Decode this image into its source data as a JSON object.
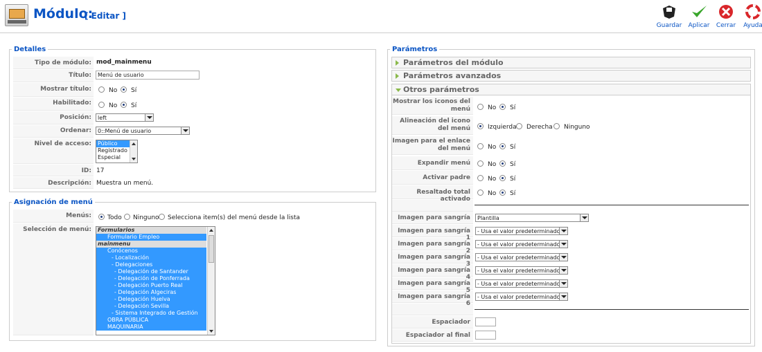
{
  "header": {
    "title": "Módulo:",
    "subtitle": "[ Editar ]",
    "toolbar": [
      {
        "label": "Guardar",
        "icon": "save-icon"
      },
      {
        "label": "Aplicar",
        "icon": "apply-icon"
      },
      {
        "label": "Cerrar",
        "icon": "close-icon"
      },
      {
        "label": "Ayuda",
        "icon": "help-icon"
      }
    ]
  },
  "details": {
    "legend": "Detalles",
    "tipo_label": "Tipo de módulo:",
    "tipo_value": "mod_mainmenu",
    "titulo_label": "Título:",
    "titulo_value": "Menú de usuario",
    "mostrar_label": "Mostrar título:",
    "habilitado_label": "Habilitado:",
    "no": "No",
    "si": "Sí",
    "posicion_label": "Posición:",
    "posicion_value": "left",
    "ordenar_label": "Ordenar:",
    "ordenar_value": "0::Menú de usuario",
    "nivel_label": "Nivel de acceso:",
    "nivel_options": [
      "Público",
      "Registrado",
      "Especial"
    ],
    "id_label": "ID:",
    "id_value": "17",
    "desc_label": "Descripción:",
    "desc_value": "Muestra un menú."
  },
  "assignment": {
    "legend": "Asignación de menú",
    "menus_label": "Menús:",
    "opt_todo": "Todo",
    "opt_ninguno": "Ninguno",
    "opt_selecciona": "Selecciona item(s) del menú desde la lista",
    "seleccion_label": "Selección de menú:",
    "items": [
      {
        "text": "Formularios",
        "kind": "hdr"
      },
      {
        "text": "Formulario Empleo",
        "kind": "sel",
        "indent": 16
      },
      {
        "text": "mainmenu",
        "kind": "hdr"
      },
      {
        "text": "Conócenos",
        "kind": "sel",
        "indent": 16
      },
      {
        "text": "- Localización",
        "kind": "sel",
        "indent": 22
      },
      {
        "text": "- Delegaciones",
        "kind": "sel",
        "indent": 22
      },
      {
        "text": "- Delegación de Santander",
        "kind": "sel",
        "indent": 26
      },
      {
        "text": "- Delegación de Ponferrada",
        "kind": "sel",
        "indent": 26
      },
      {
        "text": "- Delegación Puerto Real",
        "kind": "sel",
        "indent": 26
      },
      {
        "text": "- Delegación Algeciras",
        "kind": "sel",
        "indent": 26
      },
      {
        "text": "- Delegación Huelva",
        "kind": "sel",
        "indent": 26
      },
      {
        "text": "- Delegación Sevilla",
        "kind": "sel",
        "indent": 26
      },
      {
        "text": "- Sistema Integrado de Gestión",
        "kind": "sel",
        "indent": 22
      },
      {
        "text": "OBRA PÚBLICA",
        "kind": "sel",
        "indent": 16
      },
      {
        "text": "MAQUINARIA",
        "kind": "sel",
        "indent": 16
      }
    ]
  },
  "params": {
    "legend": "Parámetros",
    "pane1": "Parámetros del módulo",
    "pane2": "Parámetros avanzados",
    "pane3": "Otros parámetros",
    "mostrar_iconos": "Mostrar los iconos del menú",
    "alineacion": "Alineación del icono del menú",
    "opt_izquierda": "Izquierda",
    "opt_derecha": "Derecha",
    "opt_ninguno": "Ninguno",
    "imagen_enlace": "Imagen para el enlace del menú",
    "expandir": "Expandir menú",
    "activar_padre": "Activar padre",
    "resaltado": "Resaltado total activado",
    "no": "No",
    "si": "Sí",
    "sangria_label": "Imagen para sangría",
    "sangria_value": "Plantilla",
    "sangria_rows": [
      "Imagen para sangría 1",
      "Imagen para sangría 2",
      "Imagen para sangría 3",
      "Imagen para sangría 4",
      "Imagen para sangría 5",
      "Imagen para sangría 6"
    ],
    "default_value": "- Usa el valor predeterminado -",
    "espaciador": "Espaciador",
    "espaciador_final": "Espaciador al final"
  }
}
